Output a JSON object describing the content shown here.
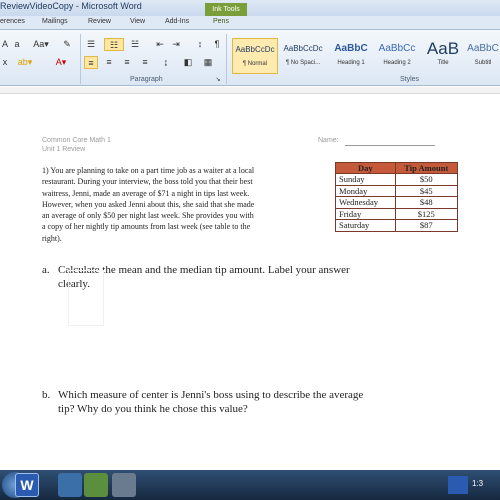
{
  "window": {
    "title": "ReviewVideoCopy - Microsoft Word",
    "context_tab": "Ink Tools"
  },
  "ribbon_tabs": [
    "erences",
    "Mailings",
    "Review",
    "View",
    "Add-Ins",
    "Pens"
  ],
  "ribbon": {
    "paragraph_label": "Paragraph",
    "styles_label": "Styles",
    "pilcrow": "¶",
    "styles": [
      {
        "sample": "AaBbCcDc",
        "name": "¶ Normal"
      },
      {
        "sample": "AaBbCcDc",
        "name": "¶ No Spaci..."
      },
      {
        "sample": "AaBbC",
        "name": "Heading 1"
      },
      {
        "sample": "AaBbCc",
        "name": "Heading 2"
      },
      {
        "sample": "AaB",
        "name": "Title"
      },
      {
        "sample": "AaBbC",
        "name": "Subtitl"
      }
    ]
  },
  "document": {
    "course": "Common Core Math 1",
    "unit": "Unit 1 Review",
    "name_label": "Name:",
    "problem_lines": [
      "1) You are planning to take on a part time job as a waiter at a local",
      "restaurant.  During your interview, the boss told you that their best",
      "waitress, Jenni, made an average of $71 a night in tips last week.",
      "However, when you asked Jenni about this, she said that she made",
      "an average of only $50 per night last week.  She provides you with",
      "a copy of her nightly tip amounts from last week (see table to the",
      "right)."
    ],
    "table": {
      "headers": [
        "Day",
        "Tip Amount"
      ],
      "rows": [
        [
          "Sunday",
          "$50"
        ],
        [
          "Monday",
          "$45"
        ],
        [
          "Wednesday",
          "$48"
        ],
        [
          "Friday",
          "$125"
        ],
        [
          "Saturday",
          "$87"
        ]
      ]
    },
    "question_a": {
      "letter": "a.",
      "lines": [
        "Calculate the mean and the median tip amount. Label your answer",
        "clearly."
      ]
    },
    "question_b": {
      "letter": "b.",
      "lines": [
        "Which measure of center is Jenni's boss using to describe the average",
        "tip?   Why do you think he chose this value?"
      ]
    }
  },
  "taskbar": {
    "word_icon_letter": "W",
    "clock": "1:3"
  }
}
